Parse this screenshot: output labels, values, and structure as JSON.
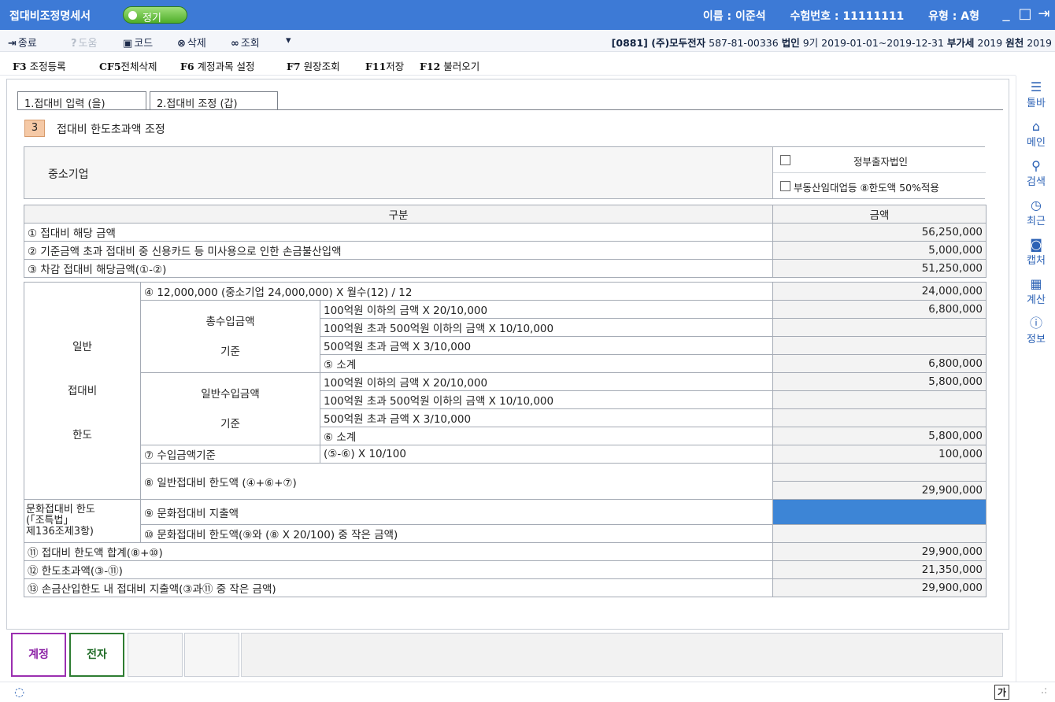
{
  "window": {
    "title": "접대비조정명세서",
    "mode": "정기",
    "user_name": "이름 : 이준석",
    "exam_number": "수험번호 : 11111111",
    "type": "유형 : A형",
    "controls": [
      "_",
      "□",
      "⇥"
    ]
  },
  "toolbar": {
    "close": "종료",
    "help": "도움",
    "code": "코드",
    "delete": "삭제",
    "lookup": "조회",
    "more": "▾",
    "company_code": "[0881] (주)모두전자",
    "biz_no": "587-81-00336",
    "corp_label": "법인",
    "corp_term": "9기 2019-01-01~2019-12-31",
    "vat_label": "부가세",
    "vat_year": "2019",
    "wh_label": "원천",
    "wh_year": "2019"
  },
  "fkeys": [
    {
      "key": "F3",
      "label": "조정등록"
    },
    {
      "key": "CF5",
      "label": "전체삭제"
    },
    {
      "key": "F6",
      "label": "계정과목 설정"
    },
    {
      "key": "F7",
      "label": "원장조회"
    },
    {
      "key": "F11",
      "label": "저장"
    },
    {
      "key": "F12",
      "label": "불러오기"
    }
  ],
  "sidebar": [
    {
      "icon": "menu-icon",
      "label": "툴바"
    },
    {
      "icon": "home-icon",
      "label": "메인"
    },
    {
      "icon": "search-icon",
      "label": "검색"
    },
    {
      "icon": "clock-icon",
      "label": "최근"
    },
    {
      "icon": "camera-icon",
      "label": "캡처"
    },
    {
      "icon": "calculator-icon",
      "label": "계산"
    },
    {
      "icon": "info-icon",
      "label": "정보"
    }
  ],
  "tabs": [
    "1.접대비 입력 (을)",
    "2.접대비 조정 (갑)"
  ],
  "section": {
    "number": "3",
    "title": "접대비 한도초과액 조정"
  },
  "company_type": {
    "label": "중소기업",
    "option1": "정부출자법인",
    "option2": "부동산임대업등 ⑧한도액 50%적용"
  },
  "grid": {
    "h_category": "구분",
    "h_amount": "금액",
    "r1_label": "① 접대비 해당 금액",
    "r1_amt": "56,250,000",
    "r2_label": "② 기준금액 초과 접대비 중 신용카드 등 미사용으로 인한 손금불산입액",
    "r2_amt": "5,000,000",
    "r3_label": "③ 차감 접대비 해당금액(①-②)",
    "r3_amt": "51,250,000",
    "gen_1": "일반",
    "gen_2": "접대비",
    "gen_3": "한도",
    "r4_label": "④ 12,000,000 (중소기업 24,000,000) X 월수(12) / 12",
    "r4_amt": "24,000,000",
    "total_rev_1": "총수입금액",
    "total_rev_2": "기준",
    "gen_rev_1": "일반수입금액",
    "gen_rev_2": "기준",
    "tier1": "100억원 이하의 금액 X 20/10,000",
    "tier2": "100억원 초과 500억원 이하의 금액 X 10/10,000",
    "tier3": "500억원 초과 금액 X 3/10,000",
    "r5_label": "⑤ 소계",
    "t_tier1_amt": "6,800,000",
    "r5_amt": "6,800,000",
    "r6_label": "⑥ 소계",
    "g_tier1_amt": "5,800,000",
    "r6_amt": "5,800,000",
    "r7_label": "⑦ 수입금액기준",
    "r7_formula": "(⑤-⑥) X 10/100",
    "r7_amt": "100,000",
    "r8_label": "⑧ 일반접대비 한도액 (④+⑥+⑦)",
    "r8_amt": "29,900,000",
    "culture_1": "문화접대비 한도",
    "culture_2": "(「조특법」",
    "culture_3": "제136조제3항)",
    "r9_label": "⑨ 문화접대비 지출액",
    "r10_label": "⑩ 문화접대비 한도액(⑨와 (⑧ X 20/100) 중 작은 금액)",
    "r11_label": "⑪ 접대비 한도액 합계(⑧+⑩)",
    "r11_amt": "29,900,000",
    "r12_label": "⑫ 한도초과액(③-⑪)",
    "r12_amt": "21,350,000",
    "r13_label": "⑬ 손금산입한도 내 접대비 지출액(③과⑪ 중 작은 금액)",
    "r13_amt": "29,900,000"
  },
  "bottom": {
    "btn1": "계정",
    "btn2": "전자"
  },
  "status": {
    "ime": "가",
    "grip": ".:"
  }
}
